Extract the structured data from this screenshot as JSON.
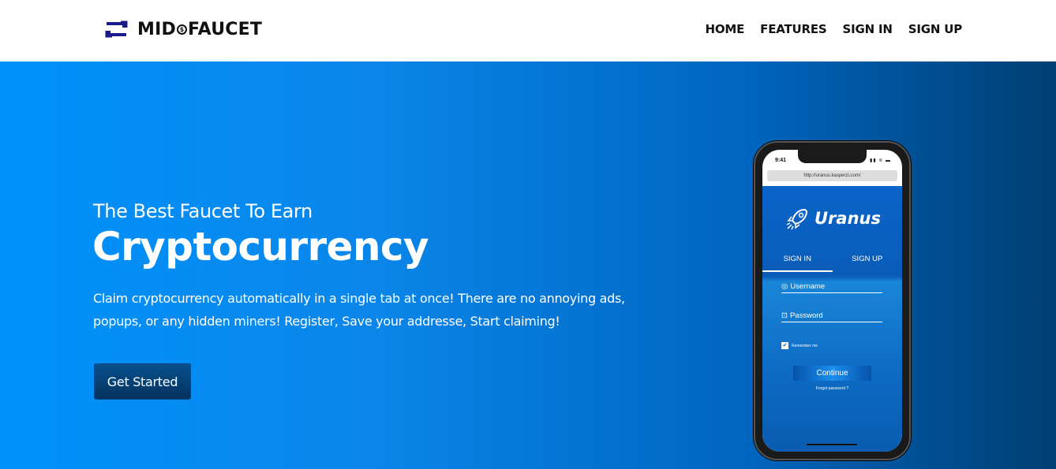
{
  "brand": {
    "name_part1": "MID",
    "coin_symbol": "$",
    "name_part2": "FAUCET",
    "logo_color": "#1a1a8c"
  },
  "nav": {
    "items": [
      "HOME",
      "FEATURES",
      "SIGN IN",
      "SIGN UP"
    ]
  },
  "hero": {
    "subtitle": "The Best Faucet To Earn",
    "title": "Cryptocurrency",
    "description": "Claim cryptocurrency automatically in a single tab at once! There are no annoying ads, popups, or any hidden miners! Register, Save your addresse, Start claiming!",
    "cta_label": "Get Started",
    "gradient": [
      "#0092fb",
      "#003f74"
    ]
  },
  "phone": {
    "time": "9:41",
    "status_icons": "▮▮ ≋ ▬",
    "url": "http://uranus.kasperzi.com/",
    "app_name": "Uranus",
    "tabs": [
      "SIGN IN",
      "SIGN UP"
    ],
    "username_placeholder": "Username",
    "password_placeholder": "Password",
    "remember_label": "Remember me",
    "continue_label": "Continue",
    "forgot_label": "Forgot password ?"
  }
}
